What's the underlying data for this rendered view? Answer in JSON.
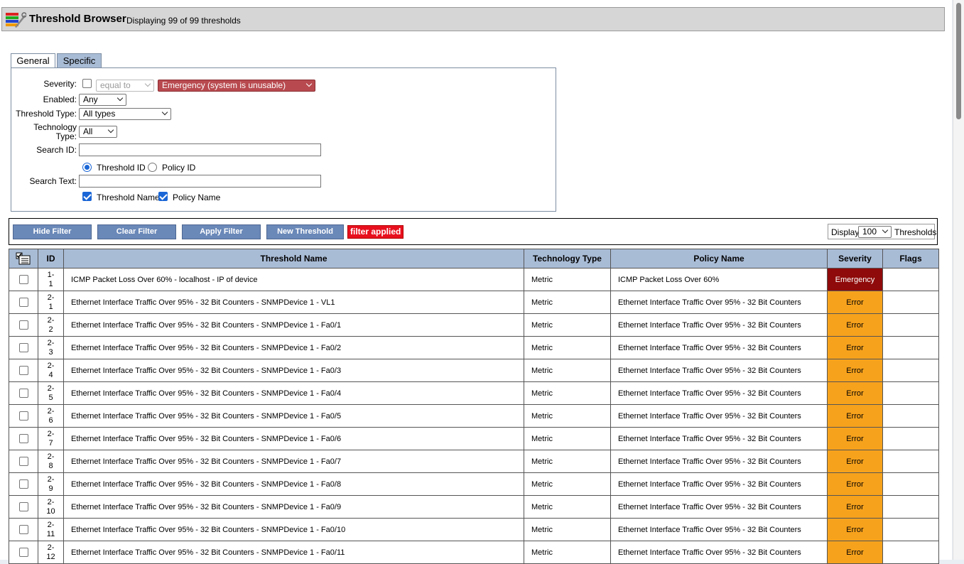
{
  "header": {
    "title": "Threshold Browser",
    "subtitle": "Displaying 99 of 99 thresholds"
  },
  "tabs": [
    {
      "label": "General"
    },
    {
      "label": "Specific"
    }
  ],
  "filter": {
    "severity_label": "Severity:",
    "severity_operator": "equal to",
    "severity_value": "Emergency (system is unusable)",
    "enabled_label": "Enabled:",
    "enabled_value": "Any",
    "threshold_type_label": "Threshold Type:",
    "threshold_type_value": "All types",
    "technology_type_label_1": "Technology",
    "technology_type_label_2": "Type:",
    "technology_type_value": "All",
    "search_id_label": "Search ID:",
    "search_id_value": "",
    "radio_threshold_id": "Threshold ID",
    "radio_policy_id": "Policy ID",
    "search_text_label": "Search Text:",
    "search_text_value": "",
    "check_threshold_name": "Threshold Name",
    "check_policy_name": "Policy Name"
  },
  "toolbar": {
    "hide_filter": "Hide Filter",
    "clear_filter": "Clear Filter",
    "apply_filter": "Apply Filter",
    "new_threshold": "New Threshold",
    "filter_applied": "filter applied",
    "display_label": "Display",
    "display_value": "100",
    "thresholds_label": "Thresholds"
  },
  "table": {
    "columns": [
      "ID",
      "Threshold Name",
      "Technology Type",
      "Policy Name",
      "Severity",
      "Flags"
    ],
    "rows": [
      {
        "id1": "1-",
        "id2": "1",
        "name": "ICMP Packet Loss Over 60% - localhost - IP of device",
        "tech": "Metric",
        "policy": "ICMP Packet Loss Over 60%",
        "severity": "Emergency",
        "flags": ""
      },
      {
        "id1": "2-",
        "id2": "1",
        "name": "Ethernet Interface Traffic Over 95% - 32 Bit Counters - SNMPDevice 1 - VL1",
        "tech": "Metric",
        "policy": "Ethernet Interface Traffic Over 95% - 32 Bit Counters",
        "severity": "Error",
        "flags": ""
      },
      {
        "id1": "2-",
        "id2": "2",
        "name": "Ethernet Interface Traffic Over 95% - 32 Bit Counters - SNMPDevice 1 - Fa0/1",
        "tech": "Metric",
        "policy": "Ethernet Interface Traffic Over 95% - 32 Bit Counters",
        "severity": "Error",
        "flags": ""
      },
      {
        "id1": "2-",
        "id2": "3",
        "name": "Ethernet Interface Traffic Over 95% - 32 Bit Counters - SNMPDevice 1 - Fa0/2",
        "tech": "Metric",
        "policy": "Ethernet Interface Traffic Over 95% - 32 Bit Counters",
        "severity": "Error",
        "flags": ""
      },
      {
        "id1": "2-",
        "id2": "4",
        "name": "Ethernet Interface Traffic Over 95% - 32 Bit Counters - SNMPDevice 1 - Fa0/3",
        "tech": "Metric",
        "policy": "Ethernet Interface Traffic Over 95% - 32 Bit Counters",
        "severity": "Error",
        "flags": ""
      },
      {
        "id1": "2-",
        "id2": "5",
        "name": "Ethernet Interface Traffic Over 95% - 32 Bit Counters - SNMPDevice 1 - Fa0/4",
        "tech": "Metric",
        "policy": "Ethernet Interface Traffic Over 95% - 32 Bit Counters",
        "severity": "Error",
        "flags": ""
      },
      {
        "id1": "2-",
        "id2": "6",
        "name": "Ethernet Interface Traffic Over 95% - 32 Bit Counters - SNMPDevice 1 - Fa0/5",
        "tech": "Metric",
        "policy": "Ethernet Interface Traffic Over 95% - 32 Bit Counters",
        "severity": "Error",
        "flags": ""
      },
      {
        "id1": "2-",
        "id2": "7",
        "name": "Ethernet Interface Traffic Over 95% - 32 Bit Counters - SNMPDevice 1 - Fa0/6",
        "tech": "Metric",
        "policy": "Ethernet Interface Traffic Over 95% - 32 Bit Counters",
        "severity": "Error",
        "flags": ""
      },
      {
        "id1": "2-",
        "id2": "8",
        "name": "Ethernet Interface Traffic Over 95% - 32 Bit Counters - SNMPDevice 1 - Fa0/7",
        "tech": "Metric",
        "policy": "Ethernet Interface Traffic Over 95% - 32 Bit Counters",
        "severity": "Error",
        "flags": ""
      },
      {
        "id1": "2-",
        "id2": "9",
        "name": "Ethernet Interface Traffic Over 95% - 32 Bit Counters - SNMPDevice 1 - Fa0/8",
        "tech": "Metric",
        "policy": "Ethernet Interface Traffic Over 95% - 32 Bit Counters",
        "severity": "Error",
        "flags": ""
      },
      {
        "id1": "2-",
        "id2": "10",
        "name": "Ethernet Interface Traffic Over 95% - 32 Bit Counters - SNMPDevice 1 - Fa0/9",
        "tech": "Metric",
        "policy": "Ethernet Interface Traffic Over 95% - 32 Bit Counters",
        "severity": "Error",
        "flags": ""
      },
      {
        "id1": "2-",
        "id2": "11",
        "name": "Ethernet Interface Traffic Over 95% - 32 Bit Counters - SNMPDevice 1 - Fa0/10",
        "tech": "Metric",
        "policy": "Ethernet Interface Traffic Over 95% - 32 Bit Counters",
        "severity": "Error",
        "flags": ""
      },
      {
        "id1": "2-",
        "id2": "12",
        "name": "Ethernet Interface Traffic Over 95% - 32 Bit Counters - SNMPDevice 1 - Fa0/11",
        "tech": "Metric",
        "policy": "Ethernet Interface Traffic Over 95% - 32 Bit Counters",
        "severity": "Error",
        "flags": ""
      }
    ]
  },
  "colors": {
    "header_blue": "#a9bcd6",
    "button_blue": "#6a88b8",
    "emergency": "#8f0a0a",
    "error": "#f7a21c",
    "filter_applied": "#e8101e"
  },
  "icons": [
    "threshold-browser-app-icon",
    "select-all-icon",
    "chevron-down-icon",
    "scrollbar-thumb"
  ]
}
